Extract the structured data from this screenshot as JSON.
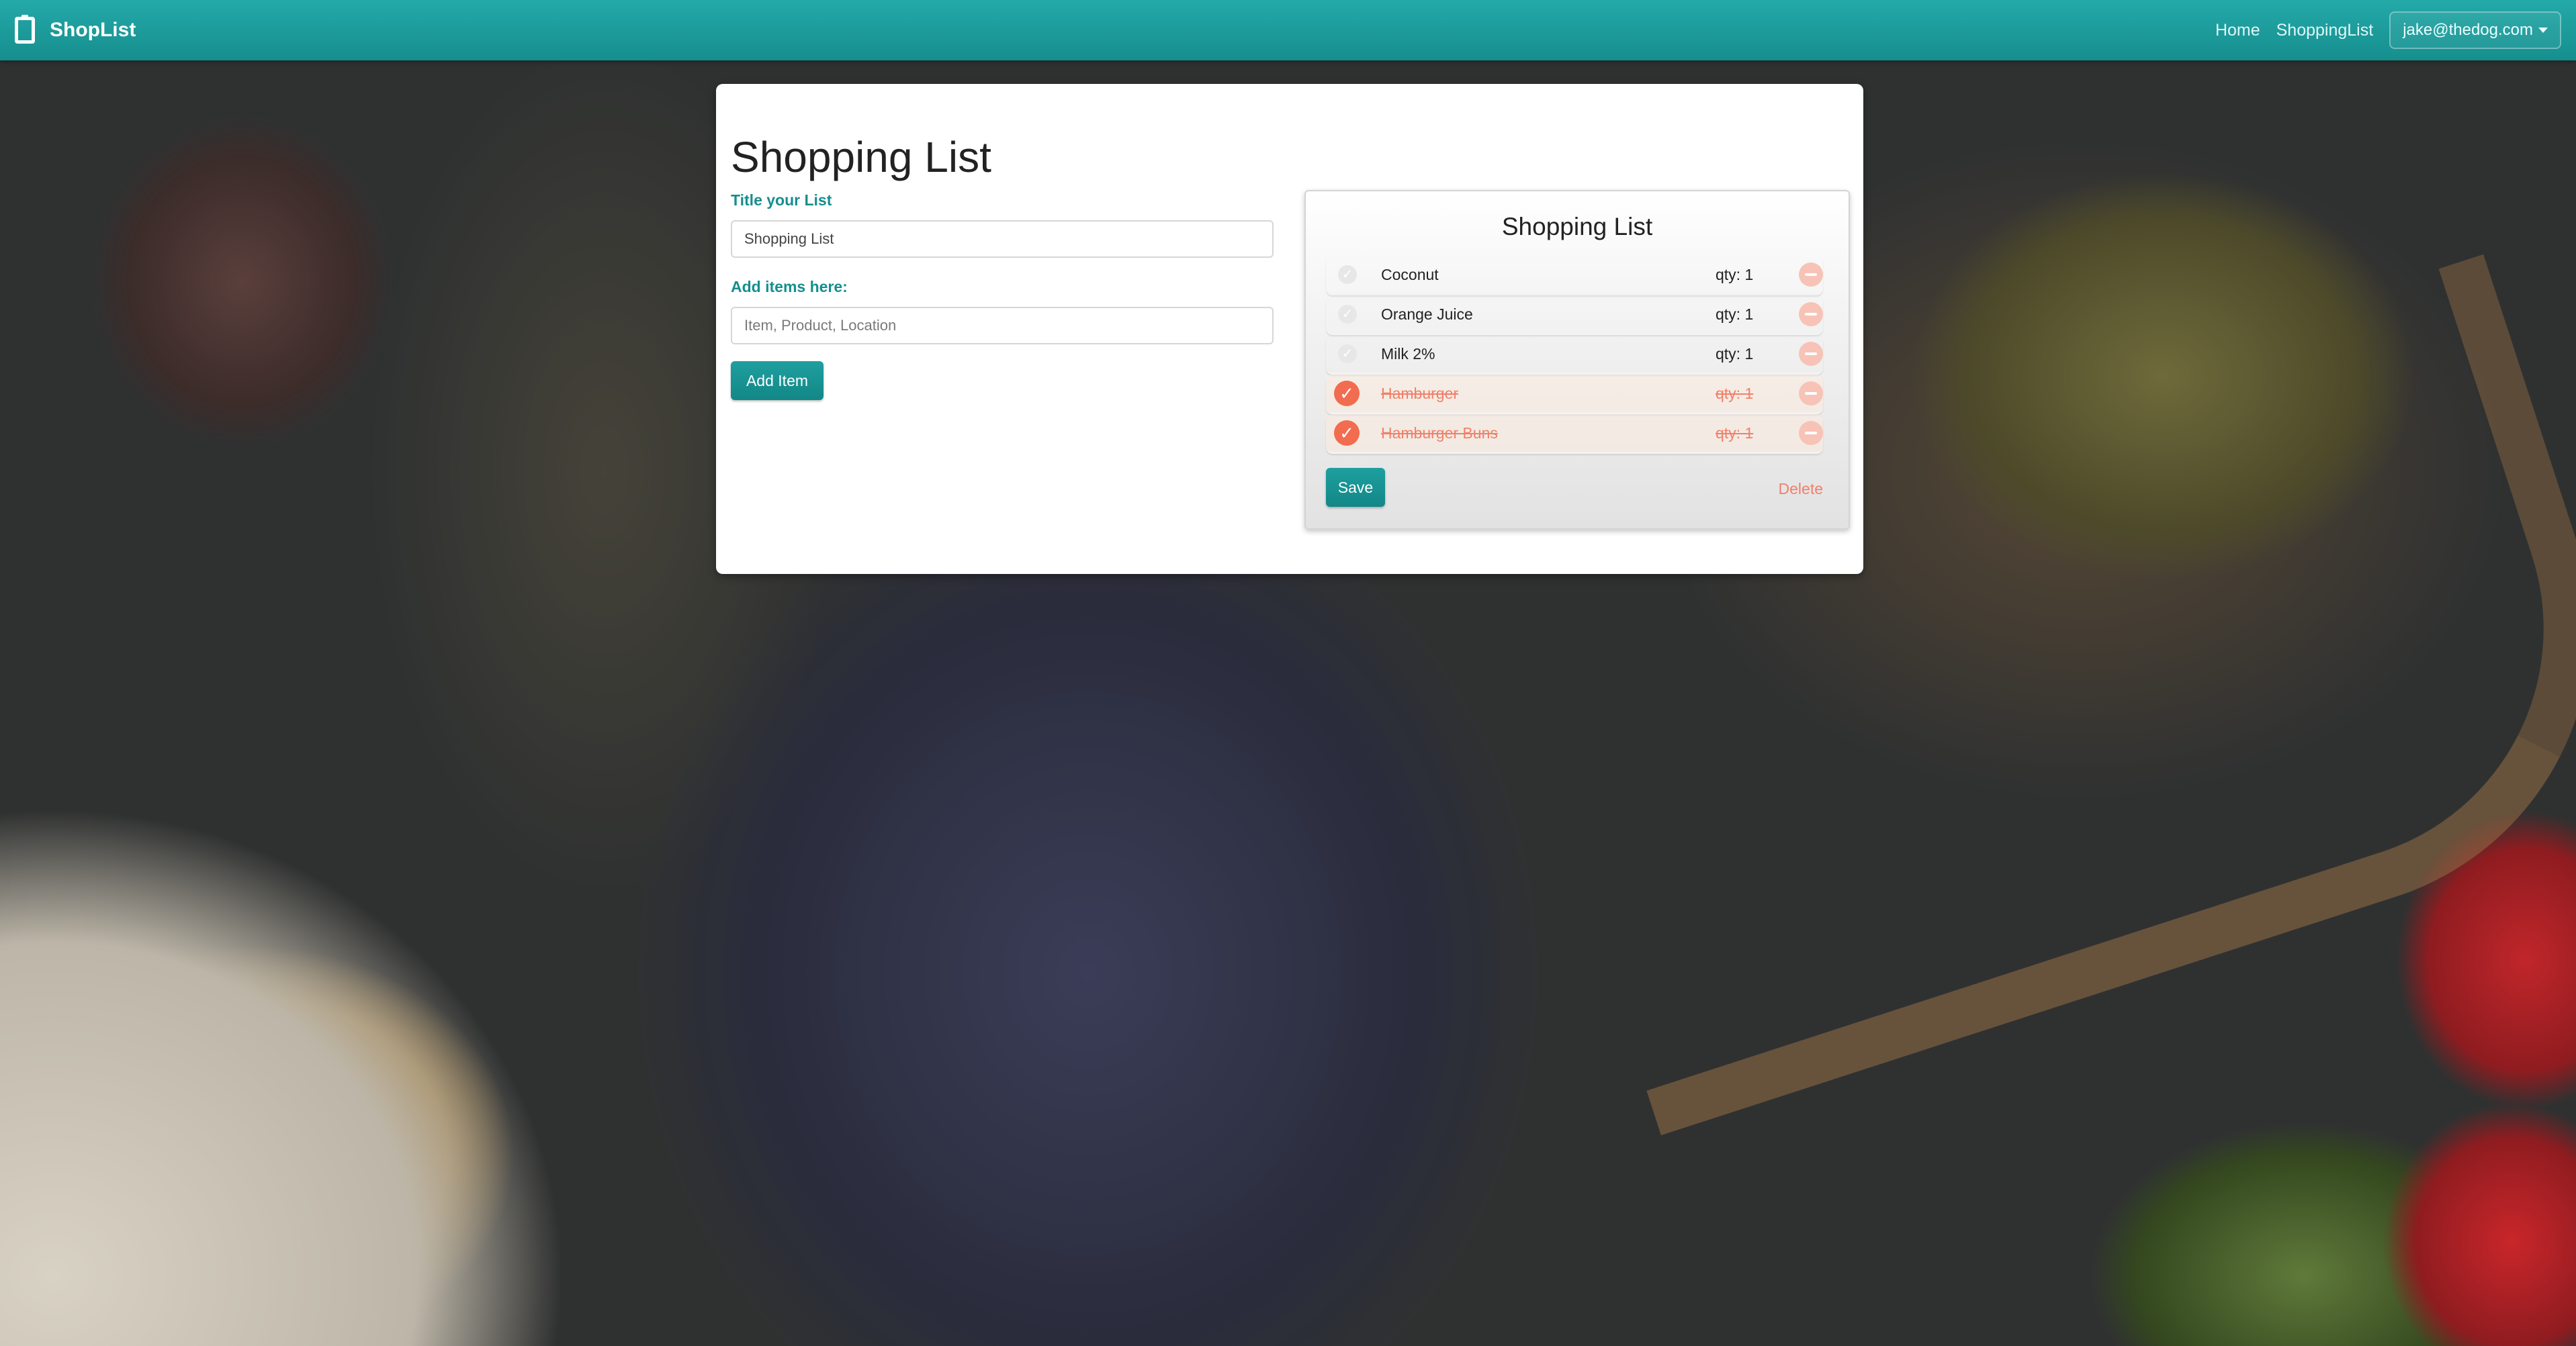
{
  "navbar": {
    "brand": "ShopList",
    "brand_icon": "clipboard-icon",
    "links": [
      "Home",
      "ShoppingList"
    ],
    "user": "jake@thedog.com"
  },
  "form": {
    "title": "Shopping List",
    "title_label": "Title your List",
    "title_value": "Shopping List",
    "items_label": "Add items here:",
    "items_placeholder": "Item, Product, Location",
    "add_button": "Add Item"
  },
  "list": {
    "title": "Shopping List",
    "items": [
      {
        "name": "Coconut",
        "qty": "qty: 1",
        "checked": false
      },
      {
        "name": "Orange Juice",
        "qty": "qty: 1",
        "checked": false
      },
      {
        "name": "Milk 2%",
        "qty": "qty: 1",
        "checked": false
      },
      {
        "name": "Hamburger",
        "qty": "qty: 1",
        "checked": true
      },
      {
        "name": "Hamburger Buns",
        "qty": "qty: 1",
        "checked": true
      }
    ],
    "save_button": "Save",
    "delete_link": "Delete"
  },
  "colors": {
    "accent": "#168e8e",
    "checked": "#f26c4f",
    "delete": "#f0816a"
  }
}
